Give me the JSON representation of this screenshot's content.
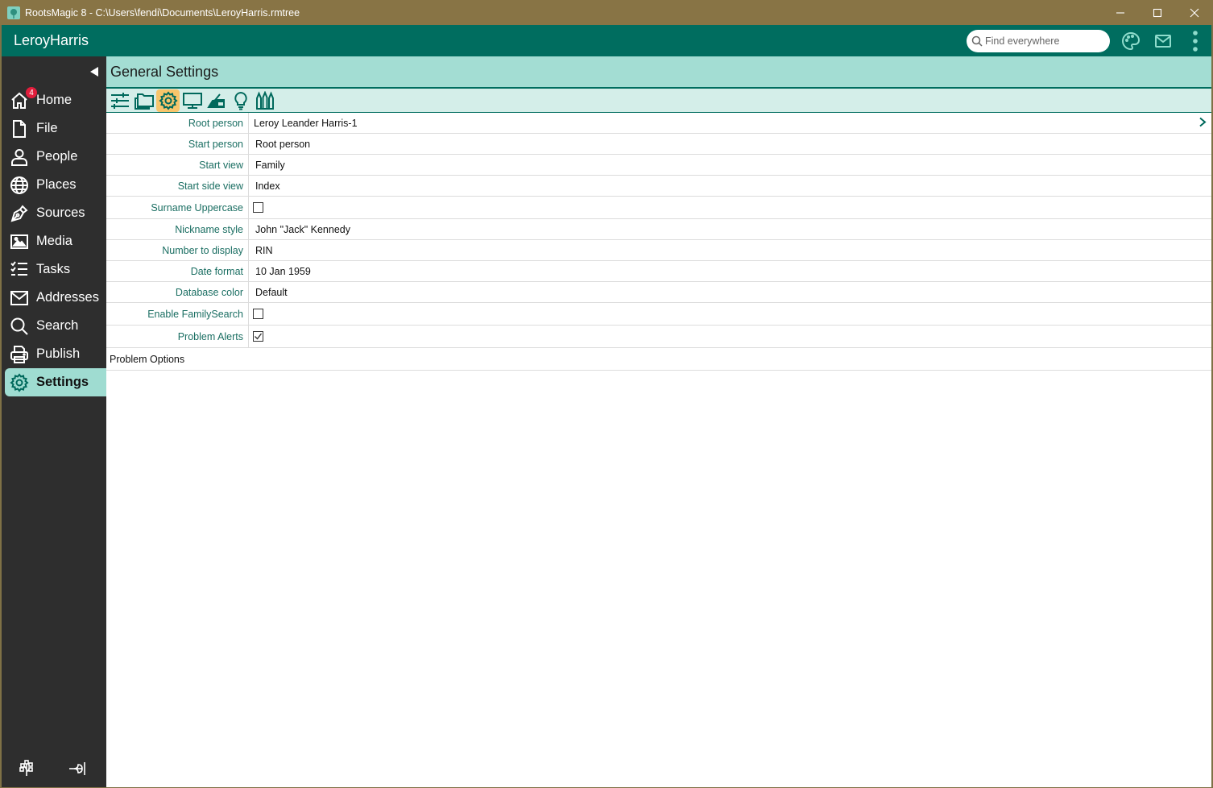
{
  "window": {
    "title": "RootsMagic 8 - C:\\Users\\fendi\\Documents\\LeroyHarris.rmtree",
    "app_icon": "rootsmagic-tree-icon",
    "controls": [
      "minimize",
      "maximize",
      "close"
    ]
  },
  "header": {
    "database_name": "LeroyHarris",
    "search_placeholder": "Find everywhere",
    "icons": [
      "palette-icon",
      "mail-icon",
      "more-vertical-icon"
    ]
  },
  "sidebar": {
    "items": [
      {
        "label": "Home",
        "icon": "home-icon",
        "badge": "4"
      },
      {
        "label": "File",
        "icon": "file-icon"
      },
      {
        "label": "People",
        "icon": "person-icon"
      },
      {
        "label": "Places",
        "icon": "globe-icon"
      },
      {
        "label": "Sources",
        "icon": "pen-nib-icon"
      },
      {
        "label": "Media",
        "icon": "image-icon"
      },
      {
        "label": "Tasks",
        "icon": "checklist-icon"
      },
      {
        "label": "Addresses",
        "icon": "envelope-icon"
      },
      {
        "label": "Search",
        "icon": "search-icon"
      },
      {
        "label": "Publish",
        "icon": "printer-icon"
      },
      {
        "label": "Settings",
        "icon": "gear-icon",
        "active": true
      }
    ],
    "bottom_icons": [
      "tree-view-icon",
      "expand-panel-icon"
    ]
  },
  "main": {
    "title": "General Settings",
    "toolbar": [
      {
        "name": "sliders-icon",
        "active": false
      },
      {
        "name": "folders-icon",
        "active": false
      },
      {
        "name": "gear-icon",
        "active": true
      },
      {
        "name": "monitor-icon",
        "active": false
      },
      {
        "name": "hand-writing-icon",
        "active": false
      },
      {
        "name": "lightbulb-icon",
        "active": false
      },
      {
        "name": "crayons-icon",
        "active": false
      }
    ],
    "settings": [
      {
        "label": "Root person",
        "value": "Leroy Leander Harris-1",
        "type": "link"
      },
      {
        "label": "Start person",
        "value": "Root person",
        "type": "select"
      },
      {
        "label": "Start view",
        "value": "Family",
        "type": "select"
      },
      {
        "label": "Start side view",
        "value": "Index",
        "type": "select"
      },
      {
        "label": "Surname Uppercase",
        "value": false,
        "type": "checkbox"
      },
      {
        "label": "Nickname style",
        "value": "John \"Jack\" Kennedy",
        "type": "select"
      },
      {
        "label": "Number to display",
        "value": "RIN",
        "type": "select"
      },
      {
        "label": "Date format",
        "value": "10 Jan 1959",
        "type": "select"
      },
      {
        "label": "Database color",
        "value": "Default",
        "type": "select"
      },
      {
        "label": "Enable FamilySearch",
        "value": false,
        "type": "checkbox"
      },
      {
        "label": "Problem Alerts",
        "value": true,
        "type": "checkbox"
      }
    ],
    "section": "Problem Options"
  }
}
